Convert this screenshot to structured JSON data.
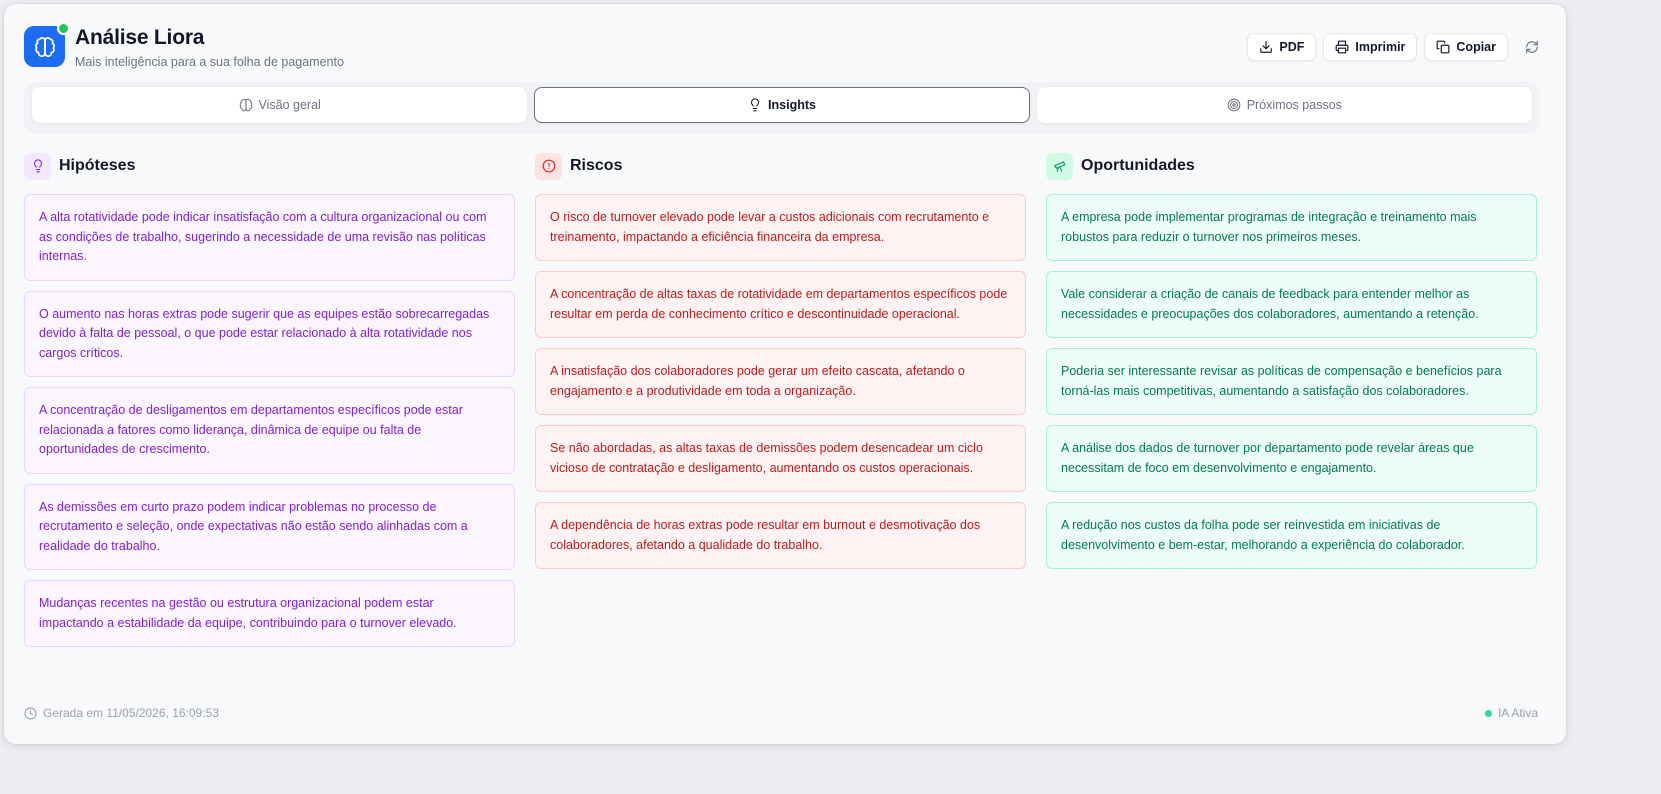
{
  "app": {
    "title": "Análise Liora",
    "subtitle": "Mais inteligência para a sua folha de pagamento",
    "brand_color": "#1d6cf2",
    "status_color": "#22c55e"
  },
  "toolbar": {
    "pdf_label": "PDF",
    "print_label": "Imprimir",
    "copy_label": "Copiar"
  },
  "tabs": [
    {
      "label": "Visão geral",
      "icon": "brain-icon",
      "active": false
    },
    {
      "label": "Insights",
      "icon": "lightbulb-icon",
      "active": true
    },
    {
      "label": "Próximos passos",
      "icon": "target-icon",
      "active": false
    }
  ],
  "sections": {
    "hypotheses": {
      "title": "Hipóteses",
      "icon": "lightbulb-icon",
      "color": "#7e22ce",
      "items": [
        "A alta rotatividade pode indicar insatisfação com a cultura organizacional ou com as condições de trabalho, sugerindo a necessidade de uma revisão nas políticas internas.",
        "O aumento nas horas extras pode sugerir que as equipes estão sobrecarregadas devido à falta de pessoal, o que pode estar relacionado à alta rotatividade nos cargos críticos.",
        "A concentração de desligamentos em departamentos específicos pode estar relacionada a fatores como liderança, dinâmica de equipe ou falta de oportunidades de crescimento.",
        "As demissões em curto prazo podem indicar problemas no processo de recrutamento e seleção, onde expectativas não estão sendo alinhadas com a realidade do trabalho.",
        "Mudanças recentes na gestão ou estrutura organizacional podem estar impactando a estabilidade da equipe, contribuindo para o turnover elevado."
      ]
    },
    "risks": {
      "title": "Riscos",
      "icon": "alert-circle-icon",
      "color": "#b91c1c",
      "items": [
        "O risco de turnover elevado pode levar a custos adicionais com recrutamento e treinamento, impactando a eficiência financeira da empresa.",
        "A concentração de altas taxas de rotatividade em departamentos específicos pode resultar em perda de conhecimento crítico e descontinuidade operacional.",
        "A insatisfação dos colaboradores pode gerar um efeito cascata, afetando o engajamento e a produtividade em toda a organização.",
        "Se não abordadas, as altas taxas de demissões podem desencadear um ciclo vicioso de contratação e desligamento, aumentando os custos operacionais.",
        "A dependência de horas extras pode resultar em burnout e desmotivação dos colaboradores, afetando a qualidade do trabalho."
      ]
    },
    "opportunities": {
      "title": "Oportunidades",
      "icon": "telescope-icon",
      "color": "#047857",
      "items": [
        "A empresa pode implementar programas de integração e treinamento mais robustos para reduzir o turnover nos primeiros meses.",
        "Vale considerar a criação de canais de feedback para entender melhor as necessidades e preocupações dos colaboradores, aumentando a retenção.",
        "Poderia ser interessante revisar as políticas de compensação e benefícios para torná-las mais competitivas, aumentando a satisfação dos colaboradores.",
        "A análise dos dados de turnover por departamento pode revelar áreas que necessitam de foco em desenvolvimento e engajamento.",
        "A redução nos custos da folha pode ser reinvestida em iniciativas de desenvolvimento e bem-estar, melhorando a experiência do colaborador."
      ]
    }
  },
  "footer": {
    "generated": "Gerada em 11/05/2026, 16:09:53",
    "ai_status": "IA Ativa"
  }
}
